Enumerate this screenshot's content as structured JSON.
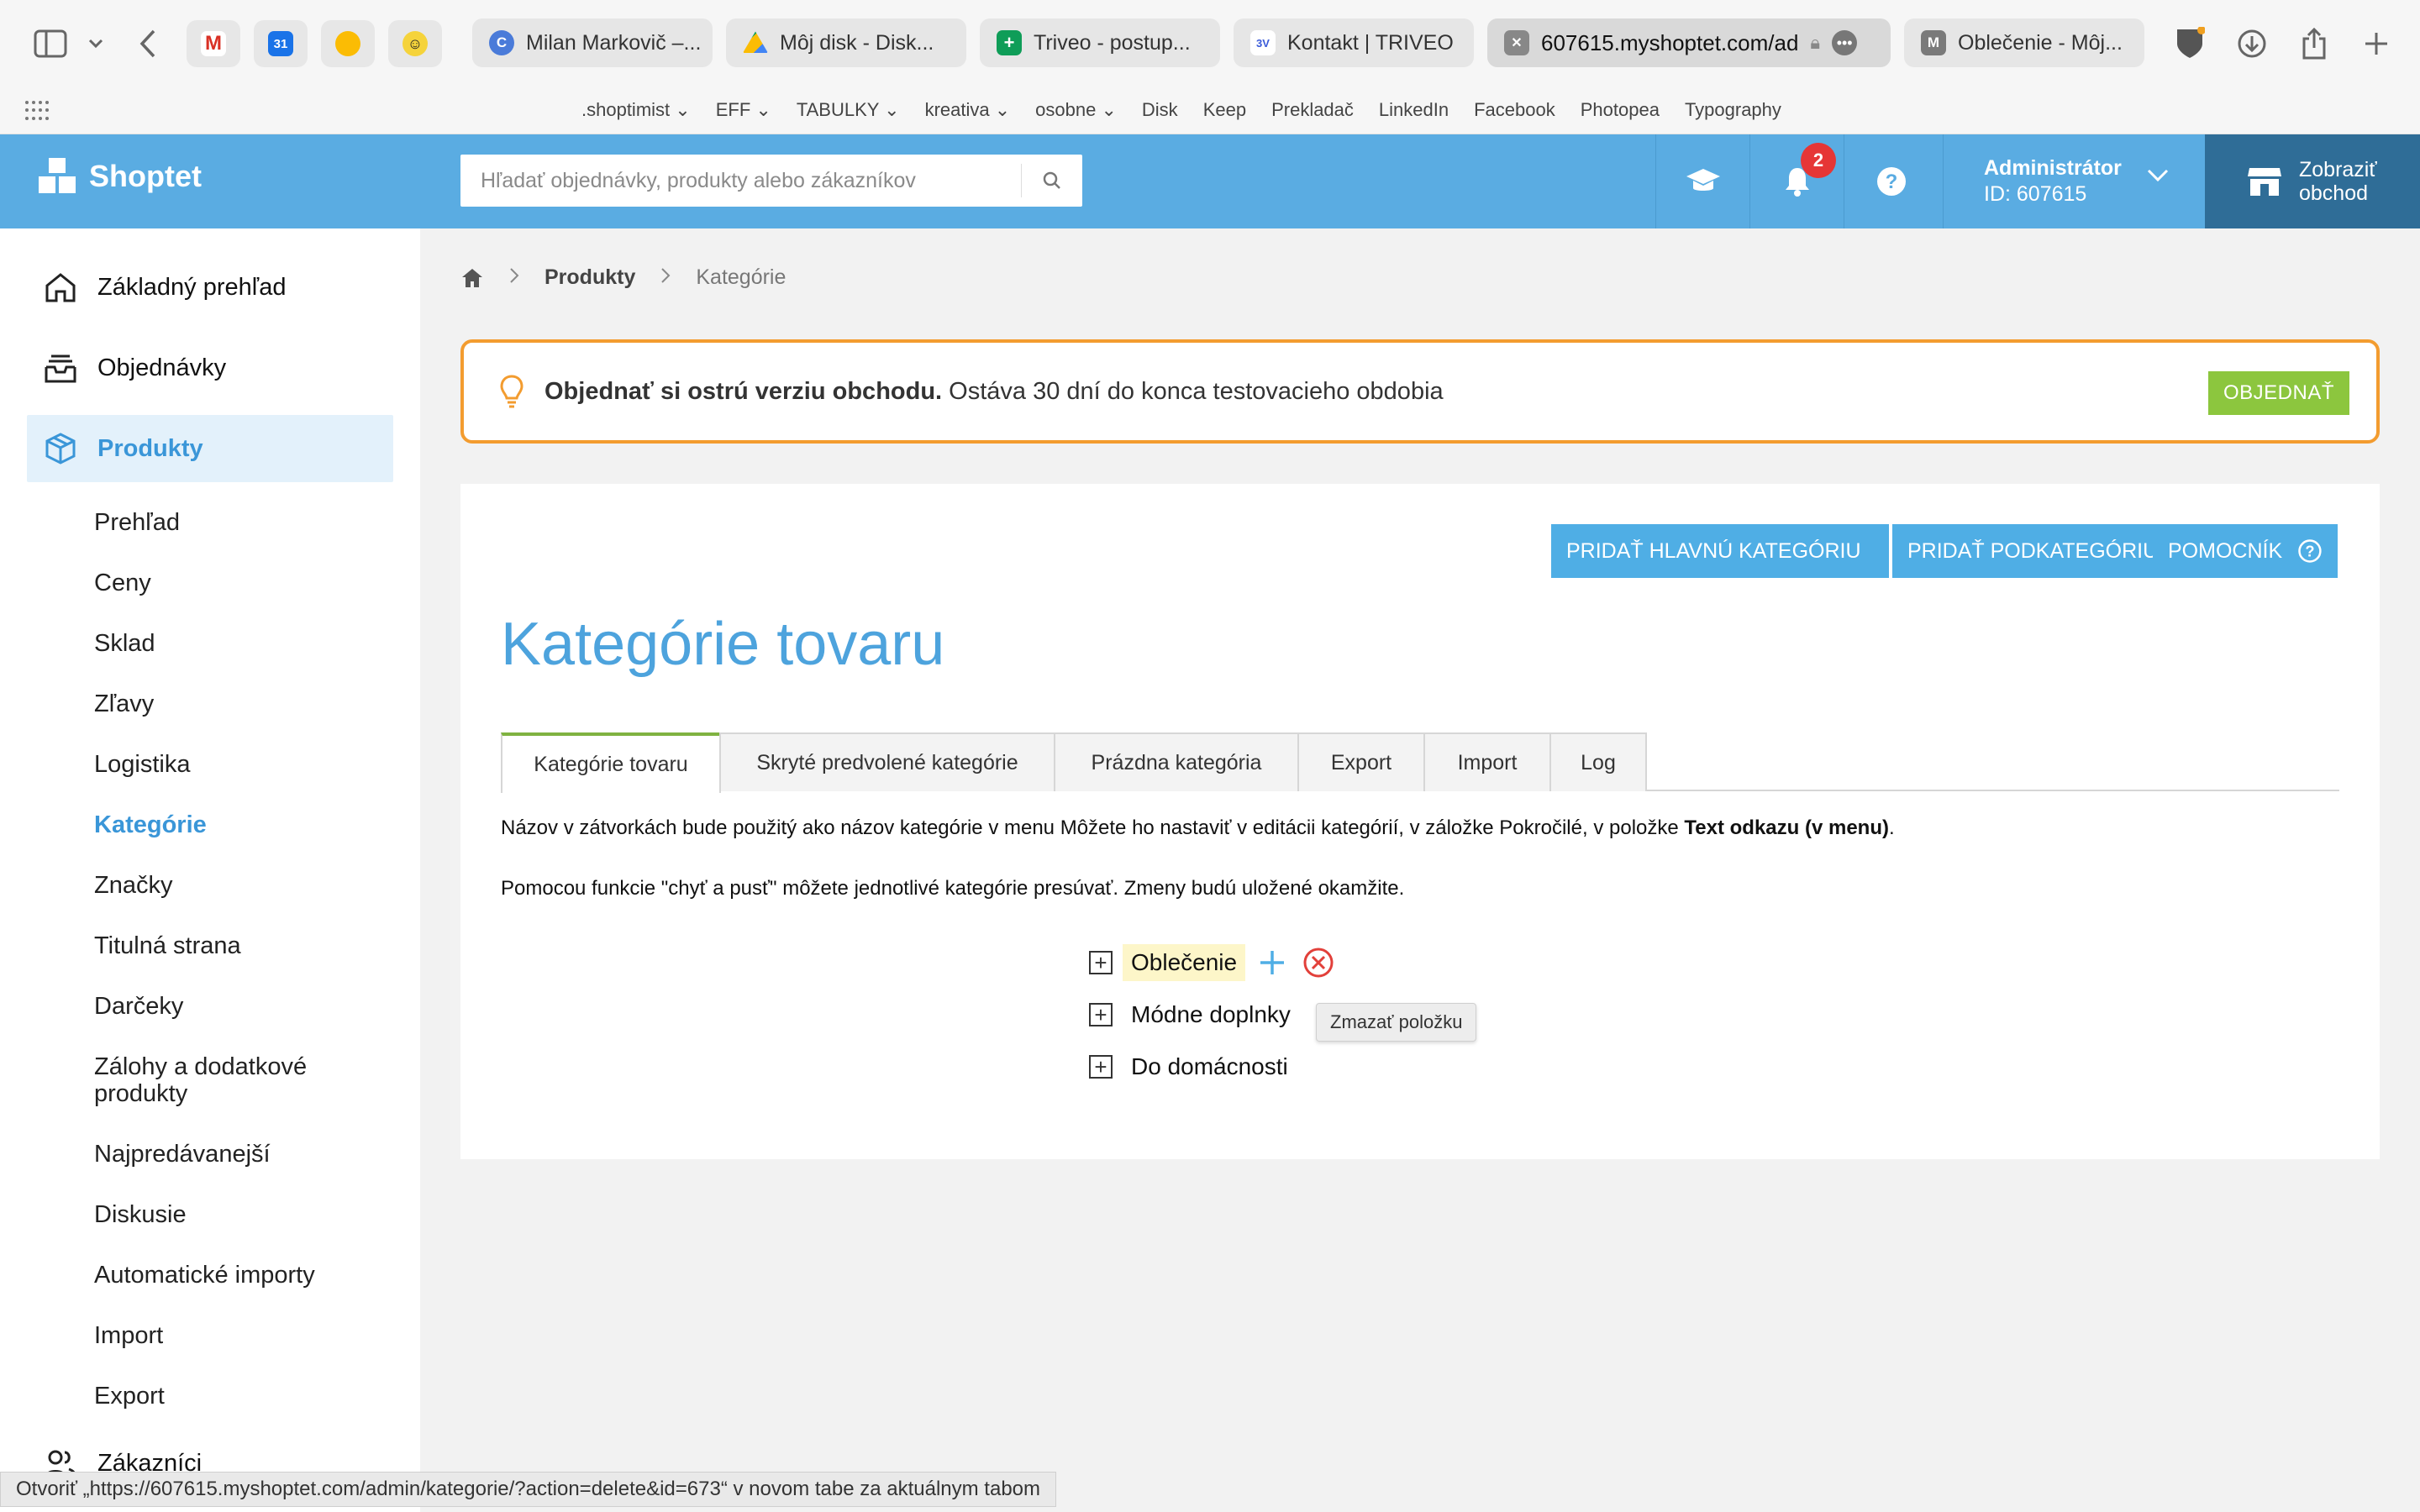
{
  "browser": {
    "pinned_tabs": [
      "Gmail",
      "Google Calendar",
      "Google Keep",
      "Basecamp"
    ],
    "tabs": [
      {
        "label": "Milan Markovič –...",
        "icon": "chrome-icon"
      },
      {
        "label": "Môj disk - Disk...",
        "icon": "drive-icon"
      },
      {
        "label": "Triveo - postup...",
        "icon": "sheets-icon"
      },
      {
        "label": "Kontakt | TRIVEO",
        "icon": "triveo-icon"
      },
      {
        "label": "607615.myshoptet.com/ad",
        "icon": "shoptet-icon",
        "active": true
      },
      {
        "label": "Oblečenie - Môj...",
        "icon": "m-icon"
      }
    ],
    "bookmarks": [
      ".shoptimist ⌄",
      "EFF ⌄",
      "TABULKY ⌄",
      "kreativa ⌄",
      "osobne ⌄",
      "Disk",
      "Keep",
      "Prekladač",
      "LinkedIn",
      "Facebook",
      "Photopea",
      "Typography"
    ],
    "status_bar": "Otvoriť „https://607615.myshoptet.com/admin/kategorie/?action=delete&id=673“ v novom tabe za aktuálnym tabom"
  },
  "header": {
    "logo": "Shoptet",
    "search_placeholder": "Hľadať objednávky, produkty alebo zákazníkov",
    "notifications_count": "2",
    "admin_name": "Administrátor",
    "admin_id": "ID: 607615",
    "store_button_line1": "Zobraziť",
    "store_button_line2": "obchod",
    "accent": "#5aace2"
  },
  "sidebar": {
    "main": [
      {
        "label": "Základný prehľad",
        "icon": "home-icon"
      },
      {
        "label": "Objednávky",
        "icon": "orders-icon"
      },
      {
        "label": "Produkty",
        "icon": "box-icon",
        "active": true
      }
    ],
    "sub": [
      "Prehľad",
      "Ceny",
      "Sklad",
      "Zľavy",
      "Logistika",
      "Kategórie",
      "Značky",
      "Titulná strana",
      "Darčeky",
      "Zálohy a dodatkové produkty",
      "Najpredávanejší",
      "Diskusie",
      "Automatické importy",
      "Import",
      "Export"
    ],
    "sub_active": "Kategórie",
    "customers": "Zákazníci"
  },
  "breadcrumb": {
    "products": "Produkty",
    "current": "Kategórie"
  },
  "notice": {
    "bold": "Objednať si ostrú verziu obchodu.",
    "text": "Ostáva 30 dní do konca testovacieho obdobia",
    "button": "OBJEDNAŤ"
  },
  "page": {
    "title": "Kategórie tovaru",
    "buttons": {
      "add_main": "PRIDAŤ HLAVNÚ KATEGÓRIU",
      "add_sub": "PRIDAŤ PODKATEGÓRIU",
      "helper": "POMOCNÍK"
    },
    "tabs": [
      "Kategórie tovaru",
      "Skryté predvolené kategórie",
      "Prázdna kategória",
      "Export",
      "Import",
      "Log"
    ],
    "info1_a": "Názov v zátvorkách bude použitý ako názov kategórie v menu Môžete ho nastaviť v editácii kategórií, v záložke Pokročilé, v položke ",
    "info1_b": "Text odkazu (v menu)",
    "info1_c": ".",
    "info2": "Pomocou funkcie \"chyť a pusť\" môžete jednotlivé kategórie presúvať. Zmeny budú uložené okamžite.",
    "categories": [
      "Oblečenie",
      "Módne doplnky",
      "Do domácnosti"
    ],
    "tooltip": "Zmazať položku"
  }
}
